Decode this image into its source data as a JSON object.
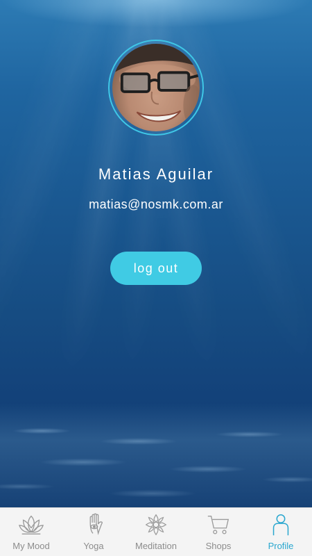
{
  "profile": {
    "name": "Matias Aguilar",
    "email": "matias@nosmk.com.ar",
    "logout_label": "log out"
  },
  "tabs": [
    {
      "label": "My Mood",
      "icon": "lotus-icon",
      "active": false
    },
    {
      "label": "Yoga",
      "icon": "hamsa-icon",
      "active": false
    },
    {
      "label": "Meditation",
      "icon": "mandala-icon",
      "active": false
    },
    {
      "label": "Shops",
      "icon": "cart-icon",
      "active": false
    },
    {
      "label": "Profile",
      "icon": "person-icon",
      "active": true
    }
  ],
  "colors": {
    "accent": "#40cbe4",
    "active_tab": "#2aa7cf",
    "inactive_tab": "#8c8c8c",
    "tabbar_bg": "#f4f4f4"
  }
}
